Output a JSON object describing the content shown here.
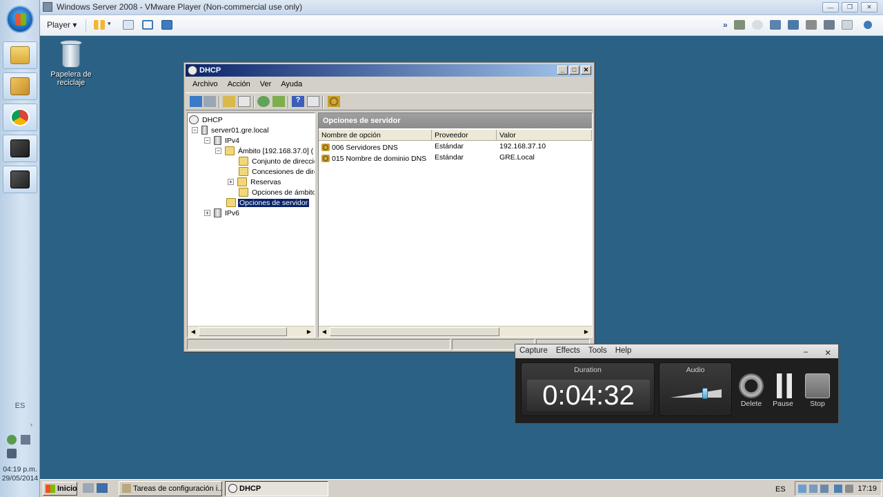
{
  "host": {
    "window_title": "Windows Server 2008 - VMware Player (Non-commercial use only)",
    "player_menu": "Player",
    "lang": "ES",
    "clock_time": "04:19 p.m.",
    "clock_date": "29/05/2014"
  },
  "guest": {
    "desktop_icon_label": "Papelera de reciclaje",
    "taskbar": {
      "start_label": "Inicio",
      "tasks": [
        "Tareas de configuración i...",
        "DHCP"
      ],
      "lang": "ES",
      "clock": "17:19"
    }
  },
  "dhcp": {
    "title": "DHCP",
    "menu": [
      "Archivo",
      "Acción",
      "Ver",
      "Ayuda"
    ],
    "tree": [
      {
        "label": "DHCP",
        "expander": ""
      },
      {
        "label": "server01.gre.local",
        "expander": "−"
      },
      {
        "label": "IPv4",
        "expander": "−"
      },
      {
        "label": "Ámbito [192.168.37.0] (",
        "expander": "−"
      },
      {
        "label": "Conjunto de direccio",
        "expander": ""
      },
      {
        "label": "Concesiones de dire",
        "expander": ""
      },
      {
        "label": "Reservas",
        "expander": "+"
      },
      {
        "label": "Opciones de ámbito",
        "expander": ""
      },
      {
        "label": "Opciones de servidor",
        "expander": ""
      },
      {
        "label": "IPv6",
        "expander": "+"
      }
    ],
    "panel_title": "Opciones de servidor",
    "columns": [
      "Nombre de opción",
      "Proveedor",
      "Valor"
    ],
    "rows": [
      {
        "name": "006 Servidores DNS",
        "vendor": "Estándar",
        "value": "192.168.37.10"
      },
      {
        "name": "015 Nombre de dominio DNS",
        "vendor": "Estándar",
        "value": "GRE.Local"
      }
    ]
  },
  "recorder": {
    "menu": [
      "Capture",
      "Effects",
      "Tools",
      "Help"
    ],
    "duration_label": "Duration",
    "duration": "0:04:32",
    "audio_label": "Audio",
    "audio_level": 0.7,
    "buttons": [
      "Delete",
      "Pause",
      "Stop"
    ]
  }
}
